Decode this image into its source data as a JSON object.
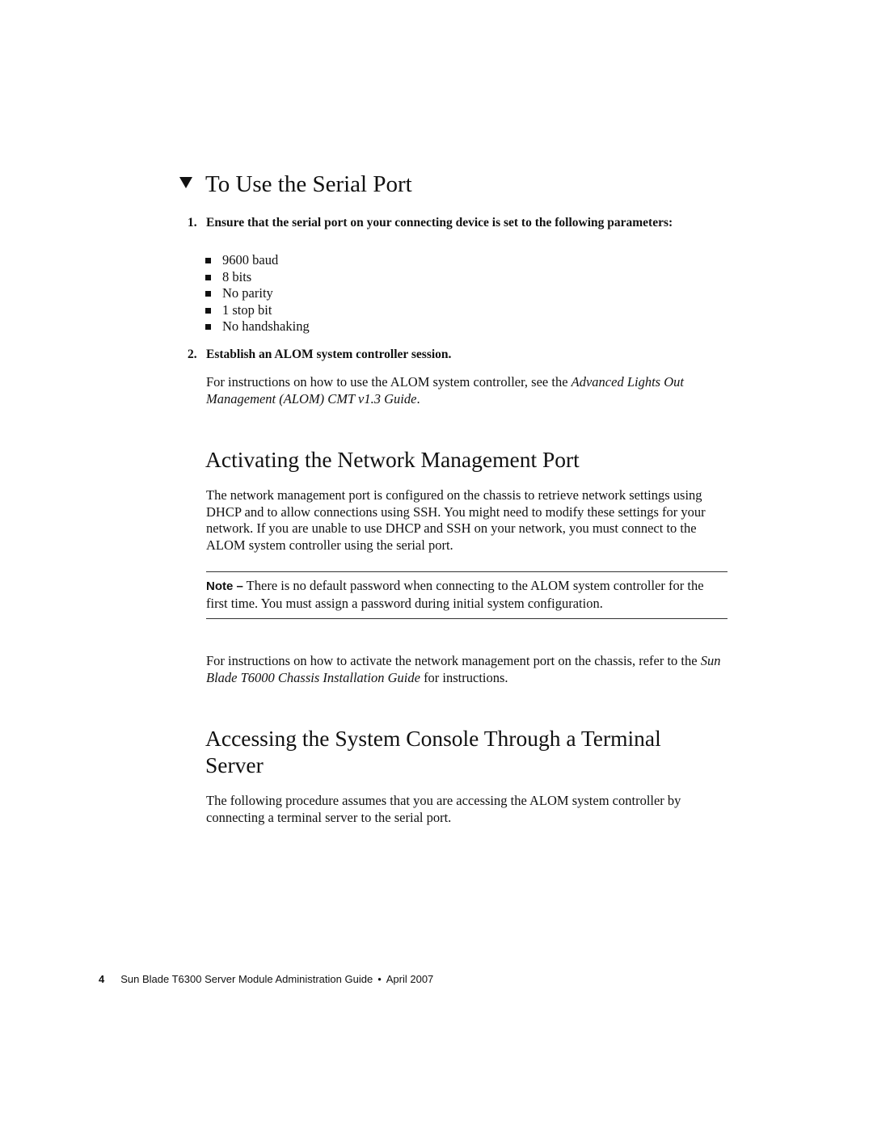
{
  "procedure": {
    "title": "To Use the Serial Port",
    "steps": [
      {
        "number": "1.",
        "text": "Ensure that the serial port on your connecting device is set to the following parameters:",
        "bullets": [
          "9600 baud",
          "8 bits",
          "No parity",
          "1 stop bit",
          "No handshaking"
        ]
      },
      {
        "number": "2.",
        "text": "Establish an ALOM system controller session.",
        "body_prefix": "For instructions on how to use the ALOM system controller, see the ",
        "body_italic": "Advanced Lights Out Management (ALOM) CMT v1.3 Guide",
        "body_suffix": "."
      }
    ]
  },
  "section_network": {
    "title": "Activating the Network Management Port",
    "paragraph": "The network management port is configured on the chassis to retrieve network settings using DHCP and to allow connections using SSH. You might need to modify these settings for your network. If you are unable to use DHCP and SSH on your network, you must connect to the ALOM system controller using the serial port.",
    "note": {
      "label": "Note –",
      "text": " There is no default password when connecting to the ALOM system controller for the first time. You must assign a password during initial system configuration."
    },
    "paragraph2_prefix": "For instructions on how to activate the network management port on the chassis, refer to the ",
    "paragraph2_italic": "Sun Blade T6000 Chassis Installation Guide",
    "paragraph2_suffix": " for instructions."
  },
  "section_console": {
    "title": "Accessing the System Console Through a Terminal Server",
    "paragraph": "The following procedure assumes that you are accessing the ALOM system controller by connecting a terminal server to the serial port."
  },
  "footer": {
    "page_number": "4",
    "doc_title": "Sun Blade T6300 Server Module Administration Guide",
    "separator": "•",
    "date": "April 2007"
  }
}
